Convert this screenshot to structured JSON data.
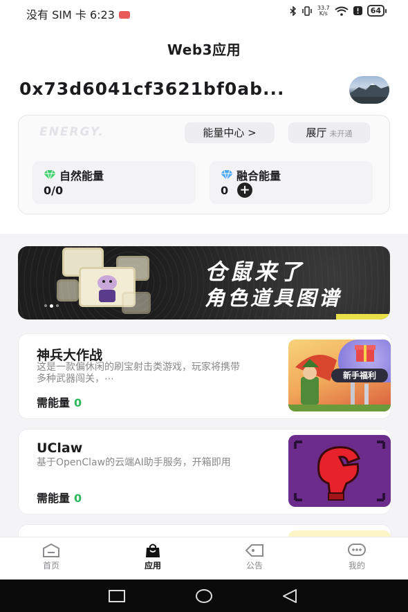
{
  "status_bar": {
    "carrier": "没有 SIM 卡",
    "time": "6:23",
    "net_speed_value": "33.7",
    "net_speed_unit": "K/s",
    "battery": "64"
  },
  "header": {
    "title": "Web3应用"
  },
  "wallet": {
    "address": "0x73d6041cf3621bf0ab..."
  },
  "energy": {
    "logo": "ENERGY.",
    "center_button": "能量中心 >",
    "hall_button": "展厅",
    "hall_status": "未开通",
    "natural": {
      "label": "自然能量",
      "value": "0/0"
    },
    "fusion": {
      "label": "融合能量",
      "value": "0"
    }
  },
  "banner": {
    "line1": "仓鼠来了",
    "line2": "角色道具图谱",
    "slide_count": 3,
    "active_slide": 2
  },
  "apps": [
    {
      "name": "神兵大作战",
      "desc": "这是一款偏休闲的刷宝射击类游戏，玩家将携带多种武器闯关，⋯",
      "need_label": "需能量",
      "need_value": "0",
      "badge": "新手福利"
    },
    {
      "name": "UClaw",
      "desc": "基于OpenClaw的云端AI助手服务，开箱即用",
      "need_label": "需能量",
      "need_value": "0"
    }
  ],
  "tabs": [
    {
      "label": "首页",
      "icon": "home-icon"
    },
    {
      "label": "应用",
      "icon": "shopping-bag-icon",
      "active": true
    },
    {
      "label": "公告",
      "icon": "tag-icon"
    },
    {
      "label": "我的",
      "icon": "chat-bubble-icon"
    }
  ],
  "colors": {
    "accent_green": "#2eb85c",
    "gem_green": "#3fd06e",
    "gem_blue": "#4aa6ff",
    "banner_bg": "#1d1d1d"
  }
}
